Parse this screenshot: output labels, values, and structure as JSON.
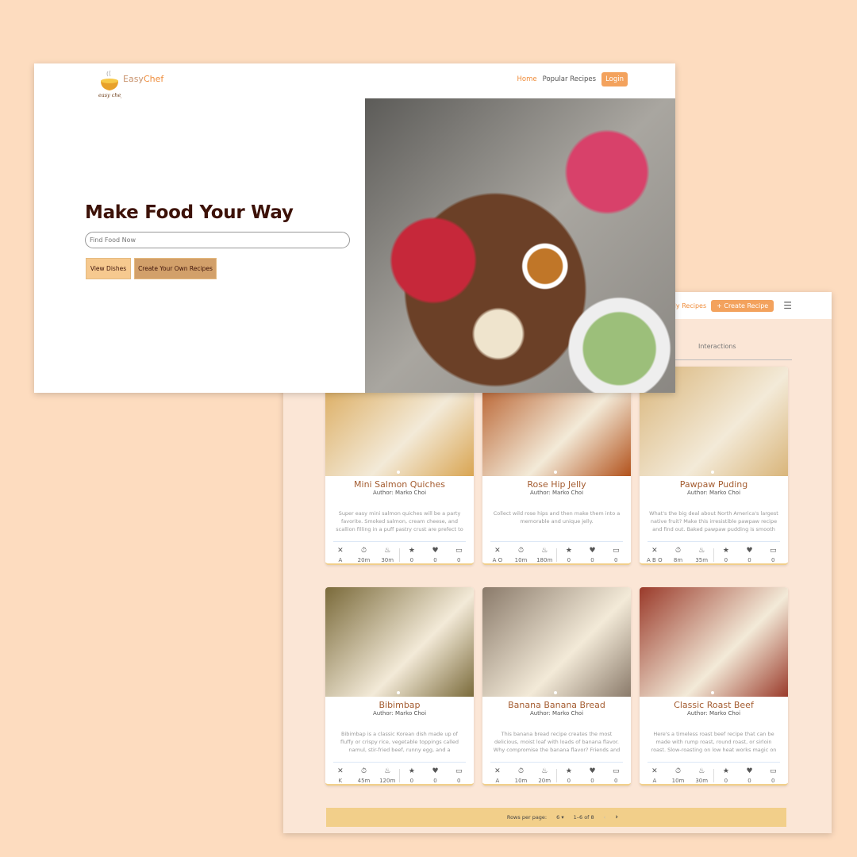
{
  "landing": {
    "brand_prefix": "Easy",
    "brand_suffix": "Chef",
    "logo_text": "easy chef",
    "nav": {
      "home": "Home",
      "popular": "Popular Recipes",
      "login": "Login"
    },
    "hero_title": "Make Food Your Way",
    "search_placeholder": "Find Food Now",
    "view_dishes": "View Dishes",
    "create_own": "Create Your Own Recipes"
  },
  "dashboard": {
    "nav": {
      "partial": "pes",
      "my_recipes": "My Recipes",
      "create": "Create Recipe",
      "create_icon": "plus-icon",
      "menu_icon": "hamburger-icon"
    },
    "tab": "Interactions",
    "recipes": [
      {
        "title": "Mini Salmon Quiches",
        "author": "Author: Marko Choi",
        "desc": "Super easy mini salmon quiches will be a party favorite. Smoked salmon, cream cheese, and scallion filling in a puff pastry crust are prefect to make ahead",
        "diet": "A",
        "prep": "20m",
        "cook": "30m",
        "rating": "0",
        "likes": "0",
        "comments": "0",
        "color": "#d9a552"
      },
      {
        "title": "Rose Hip Jelly",
        "author": "Author: Marko Choi",
        "desc": "Collect wild rose hips and then make them into a memorable and unique jelly.",
        "diet": "A O",
        "prep": "10m",
        "cook": "180m",
        "rating": "0",
        "likes": "0",
        "comments": "0",
        "color": "#b2521c"
      },
      {
        "title": "Pawpaw Puding",
        "author": "Author: Marko Choi",
        "desc": "What's the big deal about North America's largest native fruit? Make this irresistible pawpaw recipe and find out. Baked pawpaw pudding is smooth and rich.",
        "diet": "A B O",
        "prep": "8m",
        "cook": "35m",
        "rating": "0",
        "likes": "0",
        "comments": "0",
        "color": "#d9b57a"
      },
      {
        "title": "Bibimbap",
        "author": "Author: Marko Choi",
        "desc": "Bibimbap is a classic Korean dish made up of fluffy or crispy rice, vegetable toppings called namul, stir-fried beef, runny egg, and a gochujang sauce. Customize",
        "diet": "K",
        "prep": "45m",
        "cook": "120m",
        "rating": "0",
        "likes": "0",
        "comments": "0",
        "color": "#7a6a3a"
      },
      {
        "title": "Banana Banana Bread",
        "author": "Author: Marko Choi",
        "desc": "This banana bread recipe creates the most delicious, moist loaf with loads of banana flavor. Why compromise the banana flavor? Friends and family",
        "diet": "A",
        "prep": "10m",
        "cook": "20m",
        "rating": "0",
        "likes": "0",
        "comments": "0",
        "color": "#8a7a6a"
      },
      {
        "title": "Classic Roast Beef",
        "author": "Author: Marko Choi",
        "desc": "Here's a timeless roast beef recipe that can be made with rump roast, round roast, or sirloin roast. Slow-roasting on low heat works magic on tougher cuts of",
        "diet": "A",
        "prep": "10m",
        "cook": "30m",
        "rating": "0",
        "likes": "0",
        "comments": "0",
        "color": "#9a3a2a"
      }
    ],
    "pagination": {
      "rows_label": "Rows per page:",
      "rows_value": "6",
      "range": "1–6 of 8"
    }
  },
  "colors": {
    "accent": "#ef8c3a",
    "background": "#fddcbf",
    "title": "#3d1208"
  }
}
